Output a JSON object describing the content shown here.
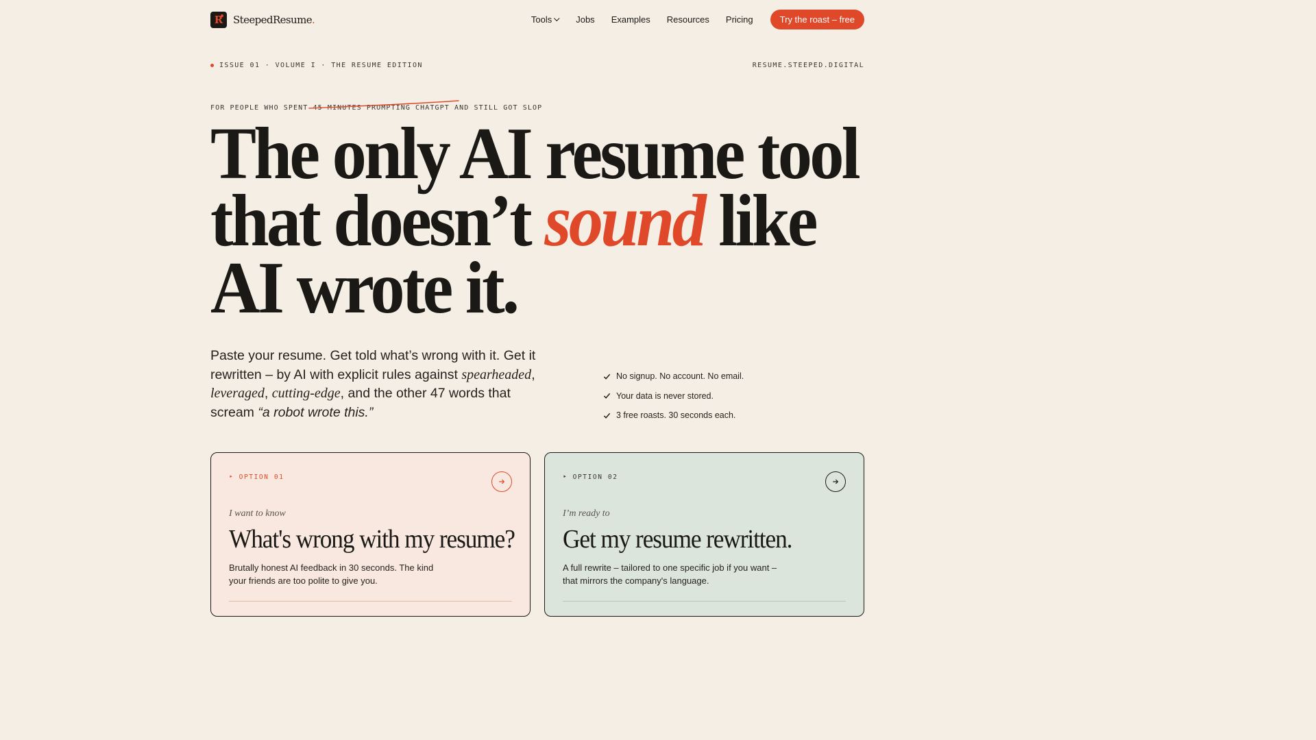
{
  "nav": {
    "brand": "SteepedResume",
    "brand_suffix": ".",
    "logo_letter": "R",
    "links": [
      "Tools",
      "Jobs",
      "Examples",
      "Resources",
      "Pricing"
    ],
    "cta": "Try the roast – free"
  },
  "issue": {
    "left": "ISSUE 01 · VOLUME I · THE RESUME EDITION",
    "right": "RESUME.STEEPED.DIGITAL"
  },
  "kicker": {
    "before": "FOR PEOPLE WHO SPENT ",
    "struck": "45 MINUTES PROMPTING CHATGPT",
    "after": " AND STILL GOT SLOP"
  },
  "headline": {
    "line1": "The only AI resume tool",
    "line2_before": "that doesn’t ",
    "line2_accent": "sound",
    "line2_after": " like",
    "line3": "AI wrote it."
  },
  "sub": {
    "p1": "Paste your resume. Get told what’s wrong with it. Get it rewritten – by AI with explicit rules against ",
    "w1": "spearheaded",
    "sep1": ", ",
    "w2": "leveraged",
    "sep2": ", ",
    "w3": "cutting-edge",
    "p2": ", and the other 47 words that scream ",
    "quote": "“a robot wrote this.”"
  },
  "checks": [
    "No signup. No account. No email.",
    "Your data is never stored.",
    "3 free roasts. 30 seconds each."
  ],
  "cards": [
    {
      "option": "‣ OPTION 01",
      "lead": "I want to know",
      "title": "What's wrong with my resume?",
      "desc": "Brutally honest AI feedback in 30 seconds. The kind your friends are too polite to give you."
    },
    {
      "option": "‣ OPTION 02",
      "lead": "I’m ready to",
      "title": "Get my resume rewritten.",
      "desc": "A full rewrite – tailored to one specific job if you want – that mirrors the company's language."
    }
  ],
  "colors": {
    "background": "#f4eee4",
    "accent": "#e0482a",
    "ink": "#1b1915",
    "card1": "#f9e8df",
    "card2": "#dce5db"
  }
}
